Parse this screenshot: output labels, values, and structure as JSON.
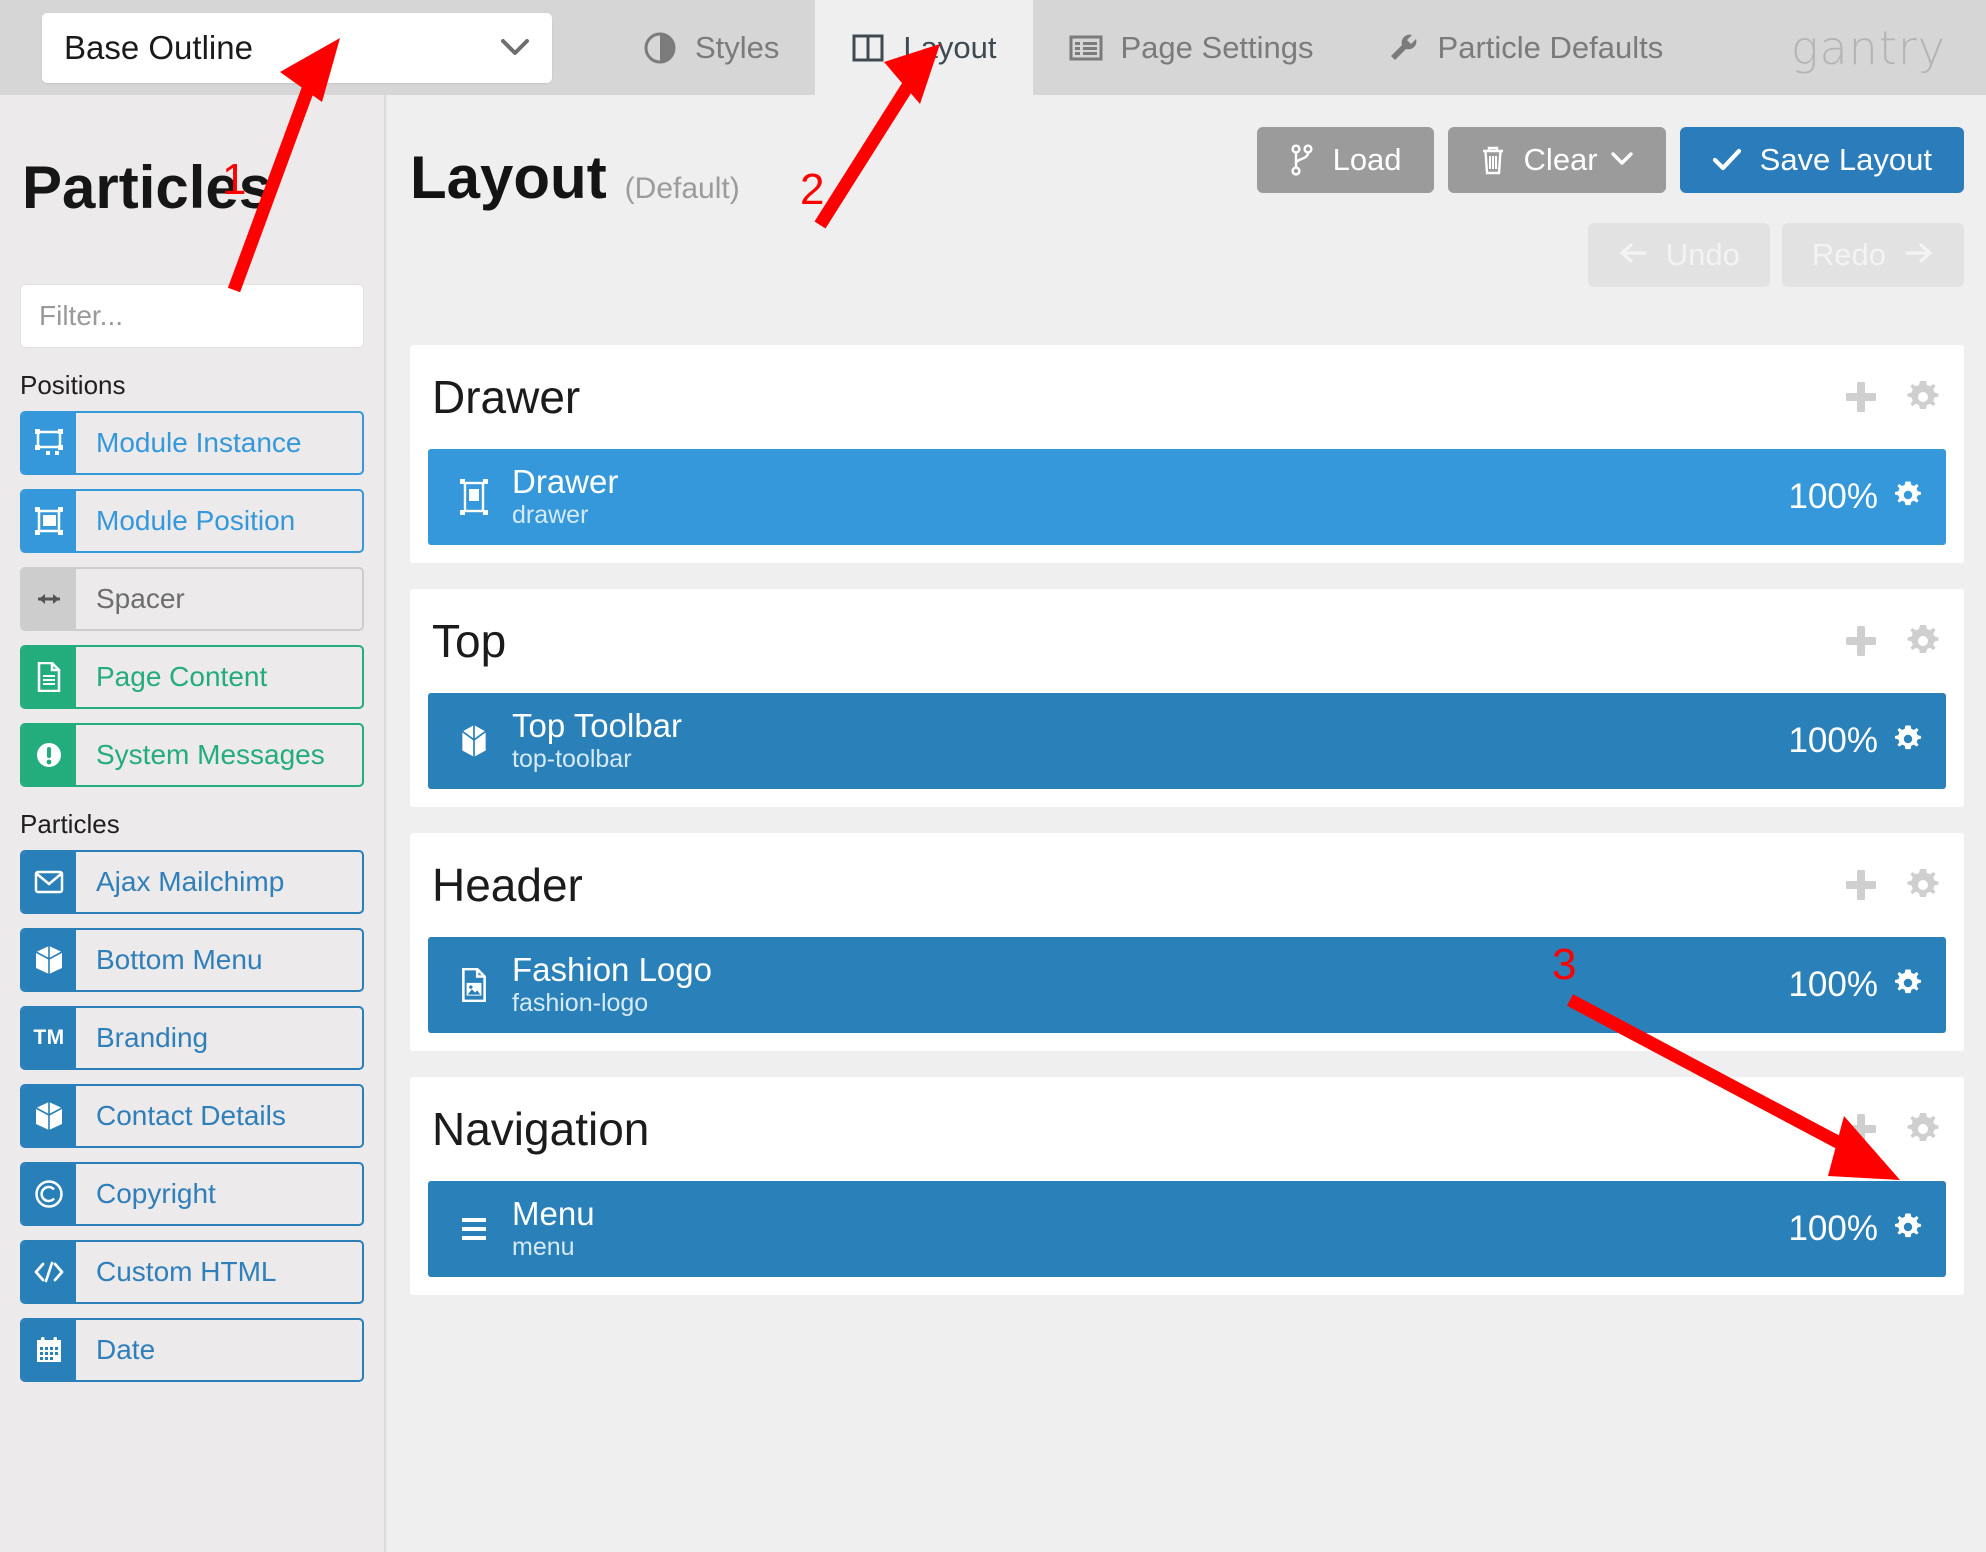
{
  "topbar": {
    "outline_select": {
      "value": "Base Outline",
      "caret_icon": "chevron-down-icon"
    },
    "tabs": [
      {
        "label": "Styles",
        "icon": "contrast-icon",
        "active": false
      },
      {
        "label": "Layout",
        "icon": "columns-icon",
        "active": true
      },
      {
        "label": "Page Settings",
        "icon": "list-alt-icon",
        "active": false
      },
      {
        "label": "Particle Defaults",
        "icon": "wrench-icon",
        "active": false
      }
    ],
    "brand": "gantry"
  },
  "sidebar": {
    "title": "Particles",
    "filter": {
      "placeholder": "Filter...",
      "value": "",
      "icon": "search-icon"
    },
    "groups": [
      {
        "label": "Positions",
        "items": [
          {
            "label": "Module Instance",
            "icon": "module-instance-icon",
            "style": "blue-light"
          },
          {
            "label": "Module Position",
            "icon": "module-position-icon",
            "style": "blue-light"
          },
          {
            "label": "Spacer",
            "icon": "arrows-h-icon",
            "style": "grey"
          },
          {
            "label": "Page Content",
            "icon": "file-text-icon",
            "style": "green"
          },
          {
            "label": "System Messages",
            "icon": "exclamation-circle-icon",
            "style": "green"
          }
        ]
      },
      {
        "label": "Particles",
        "items": [
          {
            "label": "Ajax Mailchimp",
            "icon": "envelope-icon",
            "style": "blue-dark"
          },
          {
            "label": "Bottom Menu",
            "icon": "cube-icon",
            "style": "blue-dark"
          },
          {
            "label": "Branding",
            "icon": "trademark-icon",
            "style": "blue-dark"
          },
          {
            "label": "Contact Details",
            "icon": "cube-icon",
            "style": "blue-dark"
          },
          {
            "label": "Copyright",
            "icon": "copyright-icon",
            "style": "blue-dark"
          },
          {
            "label": "Custom HTML",
            "icon": "code-icon",
            "style": "blue-dark"
          },
          {
            "label": "Date",
            "icon": "calendar-icon",
            "style": "blue-dark"
          }
        ]
      }
    ]
  },
  "main": {
    "page_title": "Layout",
    "page_title_suffix": "(Default)",
    "buttons": {
      "load": {
        "label": "Load",
        "icon": "code-fork-icon"
      },
      "clear": {
        "label": "Clear",
        "icon": "trash-icon",
        "caret_icon": "chevron-down-icon"
      },
      "save": {
        "label": "Save Layout",
        "icon": "check-icon"
      },
      "undo": {
        "label": "Undo",
        "icon": "arrow-left-icon"
      },
      "redo": {
        "label": "Redo",
        "icon": "arrow-right-icon"
      }
    },
    "sections": [
      {
        "name": "Drawer",
        "add_icon": "plus-icon",
        "settings_icon": "gear-icon",
        "rows": [
          {
            "title": "Drawer",
            "key": "drawer",
            "size": "100%",
            "icon": "module-position-icon",
            "tone": "light",
            "settings_icon": "gear-icon"
          }
        ]
      },
      {
        "name": "Top",
        "add_icon": "plus-icon",
        "settings_icon": "gear-icon",
        "rows": [
          {
            "title": "Top Toolbar",
            "key": "top-toolbar",
            "size": "100%",
            "icon": "cube-icon",
            "tone": "dark",
            "settings_icon": "gear-icon"
          }
        ]
      },
      {
        "name": "Header",
        "add_icon": "plus-icon",
        "settings_icon": "gear-icon",
        "rows": [
          {
            "title": "Fashion Logo",
            "key": "fashion-logo",
            "size": "100%",
            "icon": "file-image-icon",
            "tone": "dark",
            "settings_icon": "gear-icon"
          }
        ]
      },
      {
        "name": "Navigation",
        "add_icon": "plus-icon",
        "settings_icon": "gear-icon",
        "rows": [
          {
            "title": "Menu",
            "key": "menu",
            "size": "100%",
            "icon": "bars-icon",
            "tone": "dark",
            "settings_icon": "gear-icon"
          }
        ]
      }
    ]
  },
  "annotations": {
    "color": "#ff0000",
    "markers": [
      {
        "number": "1",
        "target": "outline-select"
      },
      {
        "number": "2",
        "target": "tab-layout"
      },
      {
        "number": "3",
        "target": "fashion-logo-gear"
      }
    ]
  }
}
